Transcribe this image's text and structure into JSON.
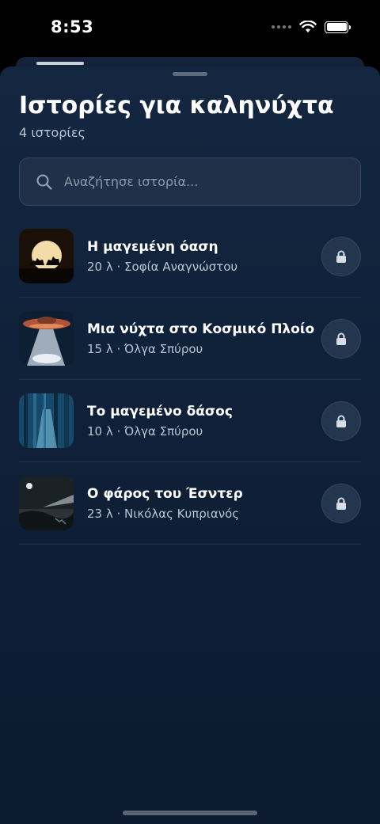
{
  "status": {
    "time": "8:53"
  },
  "colors": {
    "accent_background": "#10213a",
    "text_primary": "#ffffff",
    "text_secondary": "#b9c4d2"
  },
  "header": {
    "title": "Ιστορίες για καληνύχτα",
    "subtitle": "4 ιστορίες"
  },
  "search": {
    "placeholder": "Αναζήτησε ιστορία..."
  },
  "stories": [
    {
      "title": "Η μαγεμένη όαση",
      "meta": "20 λ · Σοφία Αναγνώστου",
      "locked": true,
      "thumbnail": "moon-camels"
    },
    {
      "title": "Μια νύχτα στο Κοσμικό Πλοίο",
      "meta": "15 λ · Όλγα Σπύρου",
      "locked": true,
      "thumbnail": "ufo-beam"
    },
    {
      "title": "Το μαγεμένο δάσος",
      "meta": "10 λ · Όλγα Σπύρου",
      "locked": true,
      "thumbnail": "blue-forest"
    },
    {
      "title": "Ο φάρος του Έσντερ",
      "meta": "23 λ · Νικόλας Κυπριανός",
      "locked": true,
      "thumbnail": "lighthouse-night"
    }
  ],
  "icons": {
    "search": "search-icon",
    "lock": "lock-icon",
    "wifi": "wifi-icon",
    "battery": "battery-icon"
  }
}
